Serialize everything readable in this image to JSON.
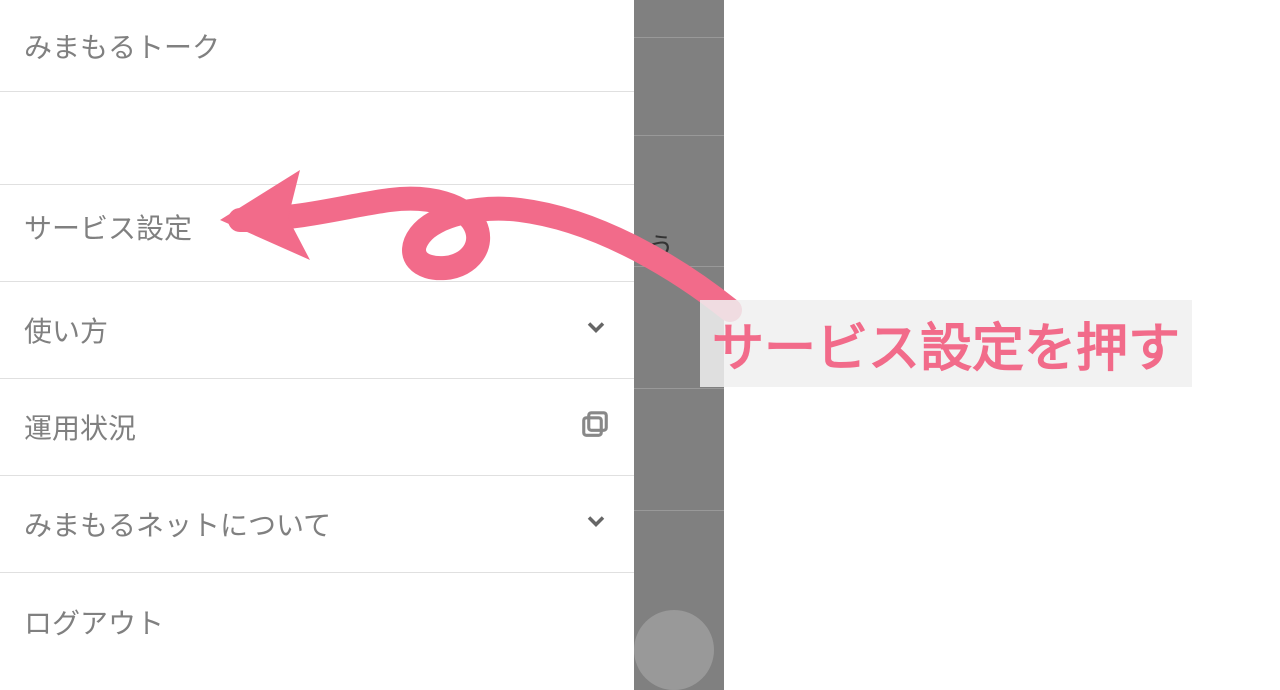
{
  "sidebar": {
    "items": [
      {
        "label": "みまもるトーク",
        "icon": null
      },
      {
        "label": "サービス設定",
        "icon": null
      },
      {
        "label": "使い方",
        "icon": "chevron"
      },
      {
        "label": "運用状況",
        "icon": "window"
      },
      {
        "label": "みまもるネットについて",
        "icon": "chevron"
      },
      {
        "label": "ログアウト",
        "icon": null
      }
    ]
  },
  "overlay": {
    "visible_char": "う"
  },
  "annotation": {
    "text": "サービス設定を押す"
  },
  "colors": {
    "accent": "#f26b8a",
    "text": "#808080",
    "divider": "#e0e0e0"
  }
}
